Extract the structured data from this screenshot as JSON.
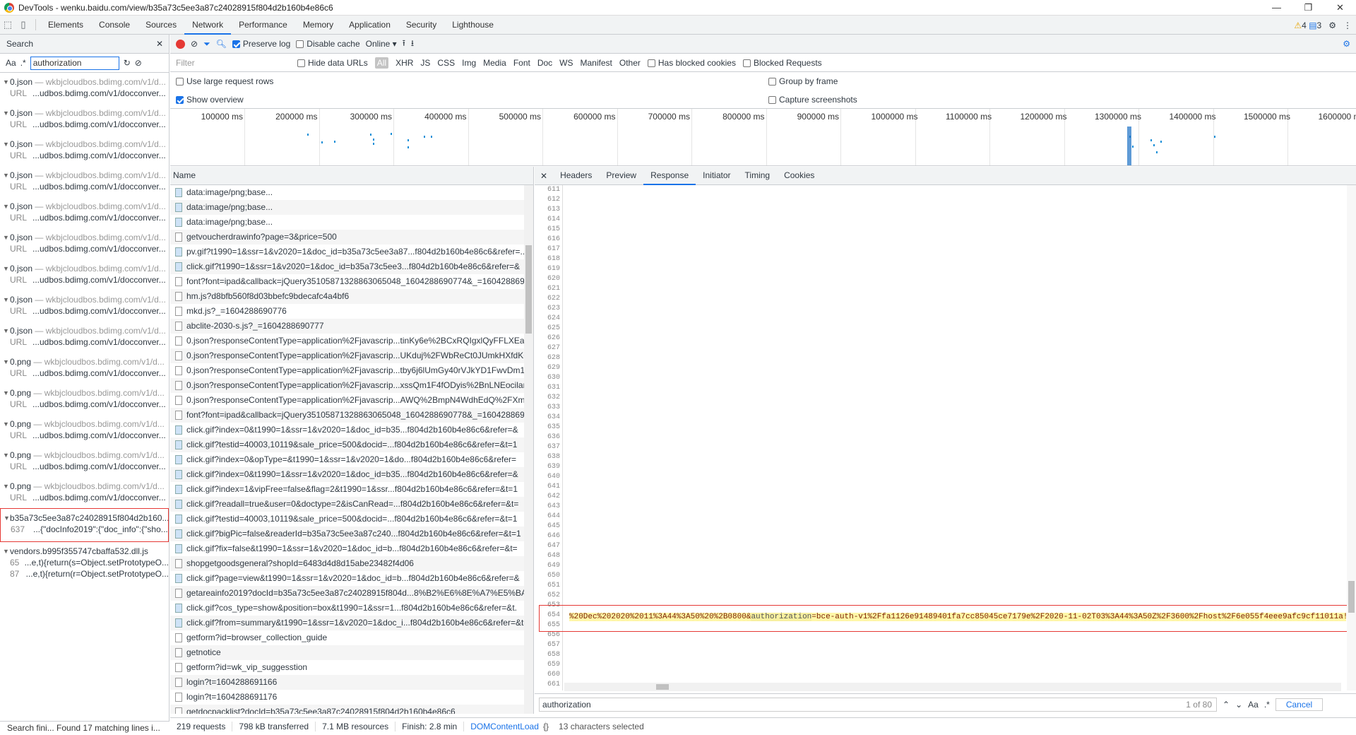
{
  "window": {
    "title": "DevTools - wenku.baidu.com/view/b35a73c5ee3a87c24028915f804d2b160b4e86c6",
    "min": "—",
    "max": "❐",
    "close": "✕"
  },
  "tabs": [
    "Elements",
    "Console",
    "Sources",
    "Network",
    "Performance",
    "Memory",
    "Application",
    "Security",
    "Lighthouse"
  ],
  "badges": {
    "warnings": "4",
    "messages": "3"
  },
  "left": {
    "header": "Search",
    "query": "authorization",
    "aa": "Aa",
    "regex": ".*",
    "results": [
      {
        "file": "0.json",
        "domain": "— wkbjcloudbos.bdimg.com/v1/d...",
        "ln": "URL",
        "text": "...udbos.bdimg.com/v1/docconver..."
      },
      {
        "file": "0.json",
        "domain": "— wkbjcloudbos.bdimg.com/v1/d...",
        "ln": "URL",
        "text": "...udbos.bdimg.com/v1/docconver..."
      },
      {
        "file": "0.json",
        "domain": "— wkbjcloudbos.bdimg.com/v1/d...",
        "ln": "URL",
        "text": "...udbos.bdimg.com/v1/docconver..."
      },
      {
        "file": "0.json",
        "domain": "— wkbjcloudbos.bdimg.com/v1/d...",
        "ln": "URL",
        "text": "...udbos.bdimg.com/v1/docconver..."
      },
      {
        "file": "0.json",
        "domain": "— wkbjcloudbos.bdimg.com/v1/d...",
        "ln": "URL",
        "text": "...udbos.bdimg.com/v1/docconver..."
      },
      {
        "file": "0.json",
        "domain": "— wkbjcloudbos.bdimg.com/v1/d...",
        "ln": "URL",
        "text": "...udbos.bdimg.com/v1/docconver..."
      },
      {
        "file": "0.json",
        "domain": "— wkbjcloudbos.bdimg.com/v1/d...",
        "ln": "URL",
        "text": "...udbos.bdimg.com/v1/docconver..."
      },
      {
        "file": "0.json",
        "domain": "— wkbjcloudbos.bdimg.com/v1/d...",
        "ln": "URL",
        "text": "...udbos.bdimg.com/v1/docconver..."
      },
      {
        "file": "0.json",
        "domain": "— wkbjcloudbos.bdimg.com/v1/d...",
        "ln": "URL",
        "text": "...udbos.bdimg.com/v1/docconver..."
      },
      {
        "file": "0.png",
        "domain": "— wkbjcloudbos.bdimg.com/v1/d...",
        "ln": "URL",
        "text": "...udbos.bdimg.com/v1/docconver..."
      },
      {
        "file": "0.png",
        "domain": "— wkbjcloudbos.bdimg.com/v1/d...",
        "ln": "URL",
        "text": "...udbos.bdimg.com/v1/docconver..."
      },
      {
        "file": "0.png",
        "domain": "— wkbjcloudbos.bdimg.com/v1/d...",
        "ln": "URL",
        "text": "...udbos.bdimg.com/v1/docconver..."
      },
      {
        "file": "0.png",
        "domain": "— wkbjcloudbos.bdimg.com/v1/d...",
        "ln": "URL",
        "text": "...udbos.bdimg.com/v1/docconver..."
      },
      {
        "file": "0.png",
        "domain": "— wkbjcloudbos.bdimg.com/v1/d...",
        "ln": "URL",
        "text": "...udbos.bdimg.com/v1/docconver..."
      }
    ],
    "hl": {
      "file": "b35a73c5ee3a87c24028915f804d2b160...",
      "ln": "637",
      "text": "...{\"docInfo2019\":{\"doc_info\":{\"sho..."
    },
    "vendors": {
      "file": "vendors.b995f355747cbaffa532.dll.js",
      "r1ln": "65",
      "r1": "...e,t){return(s=Object.setPrototypeO...",
      "r2ln": "87",
      "r2": "...e,t){return(r=Object.setPrototypeO..."
    },
    "status": "Search fini... Found 17 matching lines i..."
  },
  "toolbar": {
    "preserve": "Preserve log",
    "disable": "Disable cache",
    "online": "Online"
  },
  "filter": {
    "placeholder": "Filter",
    "hide": "Hide data URLs",
    "types": [
      "All",
      "XHR",
      "JS",
      "CSS",
      "Img",
      "Media",
      "Font",
      "Doc",
      "WS",
      "Manifest",
      "Other"
    ],
    "blocked": "Has blocked cookies",
    "blockedreq": "Blocked Requests"
  },
  "opts": {
    "large": "Use large request rows",
    "overview": "Show overview",
    "group": "Group by frame",
    "capture": "Capture screenshots"
  },
  "ticks": [
    "100000 ms",
    "200000 ms",
    "300000 ms",
    "400000 ms",
    "500000 ms",
    "600000 ms",
    "700000 ms",
    "800000 ms",
    "900000 ms",
    "1000000 ms",
    "1100000 ms",
    "1200000 ms",
    "1300000 ms",
    "1400000 ms",
    "1500000 ms",
    "1600000 m"
  ],
  "reqs": {
    "header": "Name",
    "rows": [
      "data:image/png;base...",
      "data:image/png;base...",
      "data:image/png;base...",
      "getvoucherdrawinfo?page=3&price=500",
      "pv.gif?t1990=1&ssr=1&v2020=1&doc_id=b35a73c5ee3a87...f804d2b160b4e86c6&refer=...",
      "click.gif?t1990=1&ssr=1&v2020=1&doc_id=b35a73c5ee3...f804d2b160b4e86c6&refer=&",
      "font?font=ipad&callback=jQuery35105871328863065048_1604288690774&_=160428869...",
      "hm.js?d8bfb560f8d03bbefc9bdecafc4a4bf6",
      "mkd.js?_=1604288690776",
      "abclite-2030-s.js?_=1604288690777",
      "0.json?responseContentType=application%2Fjavascrip...tinKy6e%2BCxRQIgxlQyFFLXEaSq%",
      "0.json?responseContentType=application%2Fjavascrip...UKduj%2FWbReCt0JUmkHXfdKGtE",
      "0.json?responseContentType=application%2Fjavascrip...tby6j6lUmGy40rVJkYD1FwvDm1xB",
      "0.json?responseContentType=application%2Fjavascrip...xssQm1F4fODyis%2BnLNEocilanV",
      "0.json?responseContentType=application%2Fjavascrip...AWQ%2BmpN4WdhEdQ%2FXmkP",
      "font?font=ipad&callback=jQuery35105871328863065048_1604288690778&_=160428869...",
      "click.gif?index=0&t1990=1&ssr=1&v2020=1&doc_id=b35...f804d2b160b4e86c6&refer=&",
      "click.gif?testid=40003,10119&sale_price=500&docid=...f804d2b160b4e86c6&refer=&t=1",
      "click.gif?index=0&opType=&t1990=1&ssr=1&v2020=1&do...f804d2b160b4e86c6&refer=",
      "click.gif?index=0&t1990=1&ssr=1&v2020=1&doc_id=b35...f804d2b160b4e86c6&refer=&",
      "click.gif?index=1&vipFree=false&flag=2&t1990=1&ssr...f804d2b160b4e86c6&refer=&t=1",
      "click.gif?readall=true&user=0&doctype=2&isCanRead=...f804d2b160b4e86c6&refer=&t=",
      "click.gif?testid=40003,10119&sale_price=500&docid=...f804d2b160b4e86c6&refer=&t=1",
      "click.gif?bigPic=false&readerId=b35a73c5ee3a87c240...f804d2b160b4e86c6&refer=&t=1",
      "click.gif?fix=false&t1990=1&ssr=1&v2020=1&doc_id=b...f804d2b160b4e86c6&refer=&t=",
      "shopgetgoodsgeneral?shopId=6483d4d8d15abe23482f4d06",
      "click.gif?page=view&t1990=1&ssr=1&v2020=1&doc_id=b...f804d2b160b4e86c6&refer=&",
      "getareainfo2019?docId=b35a73c5ee3a87c24028915f804d...8%B2%E6%8E%A7%E5%BA%9",
      "click.gif?cos_type=show&position=box&t1990=1&ssr=1...f804d2b160b4e86c6&refer=&t.",
      "click.gif?from=summary&t1990=1&ssr=1&v2020=1&doc_i...f804d2b160b4e86c6&refer=&t=",
      "getform?id=browser_collection_guide",
      "getnotice",
      "getform?id=wk_vip_suggesstion",
      "login?t=1604288691166",
      "login?t=1604288691176",
      "getdocpacklist?docId=b35a73c5ee3a87c24028915f804d2b160b4e86c6"
    ]
  },
  "netstatus": [
    "219 requests",
    "798 kB transferred",
    "7.1 MB resources",
    "Finish: 2.8 min",
    "DOMContentLoad"
  ],
  "detail": {
    "tabs": [
      "Headers",
      "Preview",
      "Response",
      "Initiator",
      "Timing",
      "Cookies"
    ],
    "pre": "%20Dec%202020%2011%3A44%3A50%20%2B0800&",
    "match": "authorization",
    "post": "=bce-auth-v1%2Ffa1126e91489401fa7cc85045ce7179e%2F2020-11-02T03%3A44%3A50Z%2F3600%2Fhost%2F6e055f4eee9afc9cf11011a!",
    "search": "authorization",
    "count": "1 of 80",
    "aa": "Aa",
    "regex": ".*",
    "cancel": "Cancel",
    "selected": "13 characters selected",
    "braces": "{}"
  }
}
